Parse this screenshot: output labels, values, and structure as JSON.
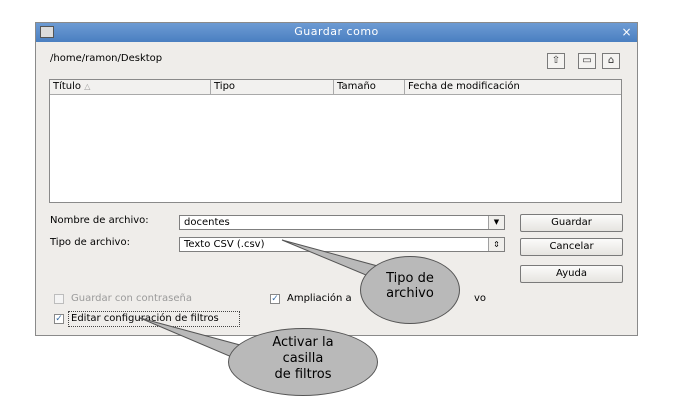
{
  "dialog": {
    "title": "Guardar como",
    "path": "/home/ramon/Desktop",
    "close_glyph": "×"
  },
  "toolbar_icons": [
    "folder-up-icon",
    "new-folder-icon",
    "default-dir-icon"
  ],
  "columns": [
    "Título",
    "Tipo",
    "Tamaño",
    "Fecha de modificación"
  ],
  "sort_indicator": "△",
  "filename": {
    "label": "Nombre de archivo:",
    "value": "docentes"
  },
  "filetype": {
    "label": "Tipo de archivo:",
    "value": "Texto CSV (.csv)"
  },
  "buttons": {
    "save": "Guardar",
    "cancel": "Cancelar",
    "help": "Ayuda"
  },
  "checkboxes": {
    "password": {
      "label": "Guardar con contraseña",
      "checked": false,
      "enabled": false
    },
    "extension": {
      "label": "Ampliación automática del nombre de archivo",
      "visible_left": "Ampliación a",
      "visible_right": "vo",
      "checked": true
    },
    "filters": {
      "label": "Editar configuración de filtros",
      "checked": true
    }
  },
  "callouts": {
    "filetype_note": {
      "line1": "Tipo de",
      "line2": "archivo"
    },
    "filters_note": {
      "line1": "Activar la",
      "line2": "casilla",
      "line3": "de filtros"
    }
  },
  "colors": {
    "titlebar": "#4a7fc1",
    "bubble": "#b9b9b9",
    "dialog_bg": "#efedea"
  }
}
